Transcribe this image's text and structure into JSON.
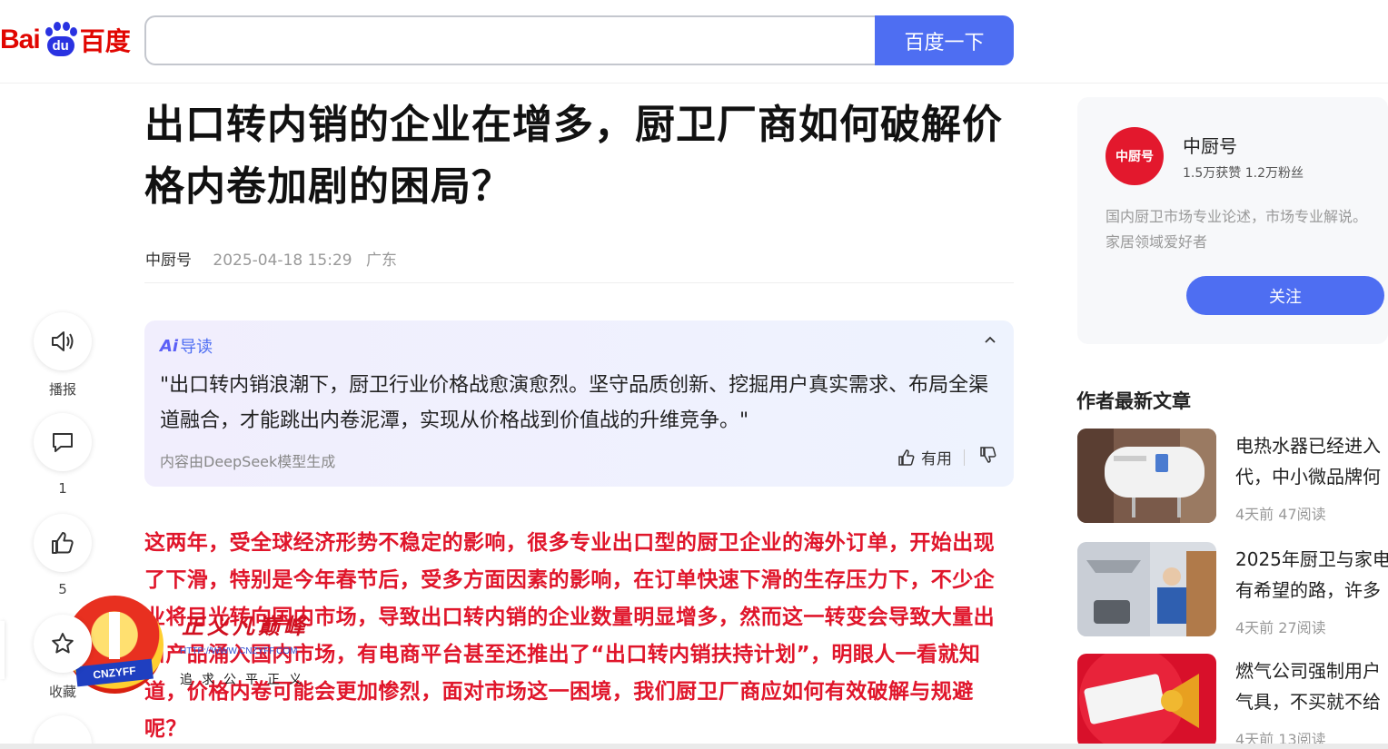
{
  "header": {
    "logo_bai": "Bai",
    "logo_du": "du",
    "logo_cn": "百度",
    "search_value": "",
    "search_button": "百度一下"
  },
  "article": {
    "title": "出口转内销的企业在增多，厨卫厂商如何破解价格内卷加剧的困局？",
    "author": "中厨号",
    "datetime": "2025-04-18 15:29",
    "location": "广东",
    "body": "这两年，受全球经济形势不稳定的影响，很多专业出口型的厨卫企业的海外订单，开始出现了下滑，特别是今年春节后，受多方面因素的影响，在订单快速下滑的生存压力下，不少企业将目光转向国内市场，导致出口转内销的企业数量明显增多，然而这一转变会导致大量出口产品涌入国内市场，有电商平台甚至还推出了“出口转内销扶持计划”，明眼人一看就知道，价格内卷可能会更加惨烈，面对市场这一困境，我们厨卫厂商应如何有效破解与规避呢？"
  },
  "ai_summary": {
    "badge": "Ai",
    "label": "导读",
    "text": "\"出口转内销浪潮下，厨卫行业价格战愈演愈烈。坚守品质创新、挖掘用户真实需求、布局全渠道融合，才能跳出内卷泥潭，实现从价格战到价值战的升维竞争。\"",
    "source": "内容由DeepSeek模型生成",
    "useful_label": "有用"
  },
  "actions": [
    {
      "name": "播报",
      "icon": "speaker-icon",
      "count": ""
    },
    {
      "name": "",
      "icon": "comment-icon",
      "count": "1"
    },
    {
      "name": "",
      "icon": "thumbs-up-icon",
      "count": "5"
    },
    {
      "name": "收藏",
      "icon": "star-icon",
      "count": ""
    }
  ],
  "author_card": {
    "avatar_text": "中厨号",
    "name": "中厨号",
    "stats": "1.5万获赞 1.2万粉丝",
    "desc_line1": "国内厨卫市场专业论述，市场专业解说。",
    "desc_line2": "家居领域爱好者",
    "follow": "关注"
  },
  "latest": {
    "title": "作者最新文章",
    "items": [
      {
        "title_l1": "电热水器已经进入",
        "title_l2": "代，中小微品牌何",
        "meta": "4天前   47阅读"
      },
      {
        "title_l1": "2025年厨卫与家电",
        "title_l2": "有希望的路，许多",
        "meta": "4天前   27阅读"
      },
      {
        "title_l1": "燃气公司强制用户",
        "title_l2": "气具，不买就不给",
        "meta": "4天前   13阅读"
      }
    ]
  },
  "watermark": {
    "calligraphy": "正义凡巅峰",
    "url": "HTTP://WWW.CNZYFF.COM",
    "motto": "追求公平正义",
    "seal_band": "CNZYFF"
  },
  "colors": {
    "brand_blue": "#4e6ef2",
    "body_red": "#e0162b",
    "logo_red": "#e10601"
  }
}
